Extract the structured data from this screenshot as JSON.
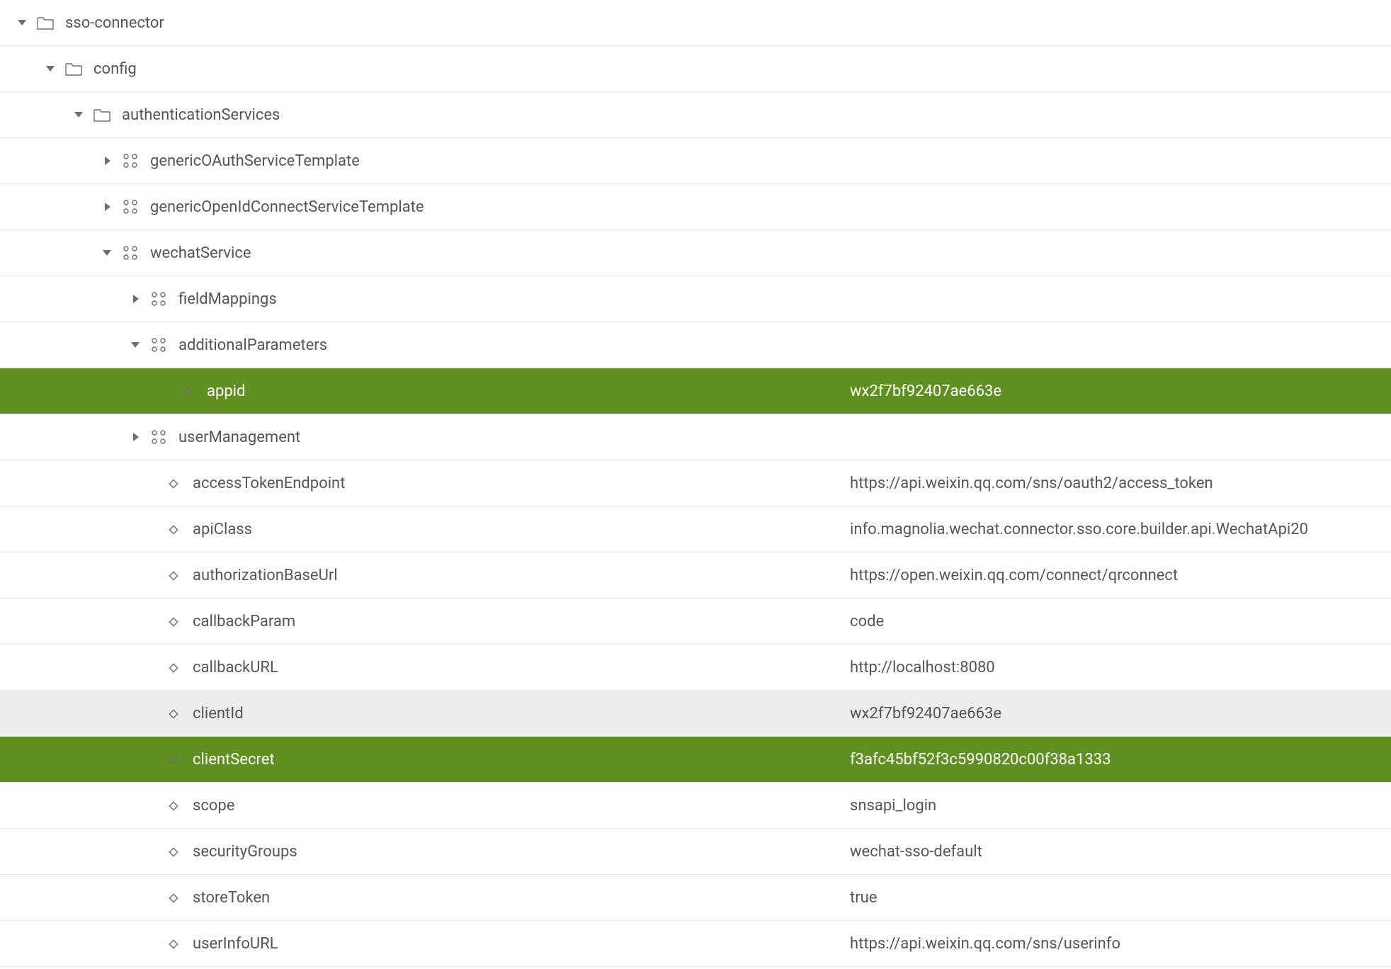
{
  "tree": {
    "root": {
      "label": "sso-connector",
      "config": {
        "label": "config",
        "authenticationServices": {
          "label": "authenticationServices",
          "genericOAuthServiceTemplate": {
            "label": "genericOAuthServiceTemplate"
          },
          "genericOpenIdConnectServiceTemplate": {
            "label": "genericOpenIdConnectServiceTemplate"
          },
          "wechatService": {
            "label": "wechatService",
            "fieldMappings": {
              "label": "fieldMappings"
            },
            "additionalParameters": {
              "label": "additionalParameters",
              "appid": {
                "label": "appid",
                "value": "wx2f7bf92407ae663e"
              }
            },
            "userManagement": {
              "label": "userManagement"
            },
            "properties": {
              "accessTokenEndpoint": {
                "label": "accessTokenEndpoint",
                "value": "https://api.weixin.qq.com/sns/oauth2/access_token"
              },
              "apiClass": {
                "label": "apiClass",
                "value": "info.magnolia.wechat.connector.sso.core.builder.api.WechatApi20"
              },
              "authorizationBaseUrl": {
                "label": "authorizationBaseUrl",
                "value": "https://open.weixin.qq.com/connect/qrconnect"
              },
              "callbackParam": {
                "label": "callbackParam",
                "value": "code"
              },
              "callbackURL": {
                "label": "callbackURL",
                "value": "http://localhost:8080"
              },
              "clientId": {
                "label": "clientId",
                "value": "wx2f7bf92407ae663e"
              },
              "clientSecret": {
                "label": "clientSecret",
                "value": "f3afc45bf52f3c5990820c00f38a1333"
              },
              "scope": {
                "label": "scope",
                "value": "snsapi_login"
              },
              "securityGroups": {
                "label": "securityGroups",
                "value": "wechat-sso-default"
              },
              "storeToken": {
                "label": "storeToken",
                "value": "true"
              },
              "userInfoURL": {
                "label": "userInfoURL",
                "value": "https://api.weixin.qq.com/sns/userinfo"
              }
            }
          }
        }
      }
    }
  }
}
